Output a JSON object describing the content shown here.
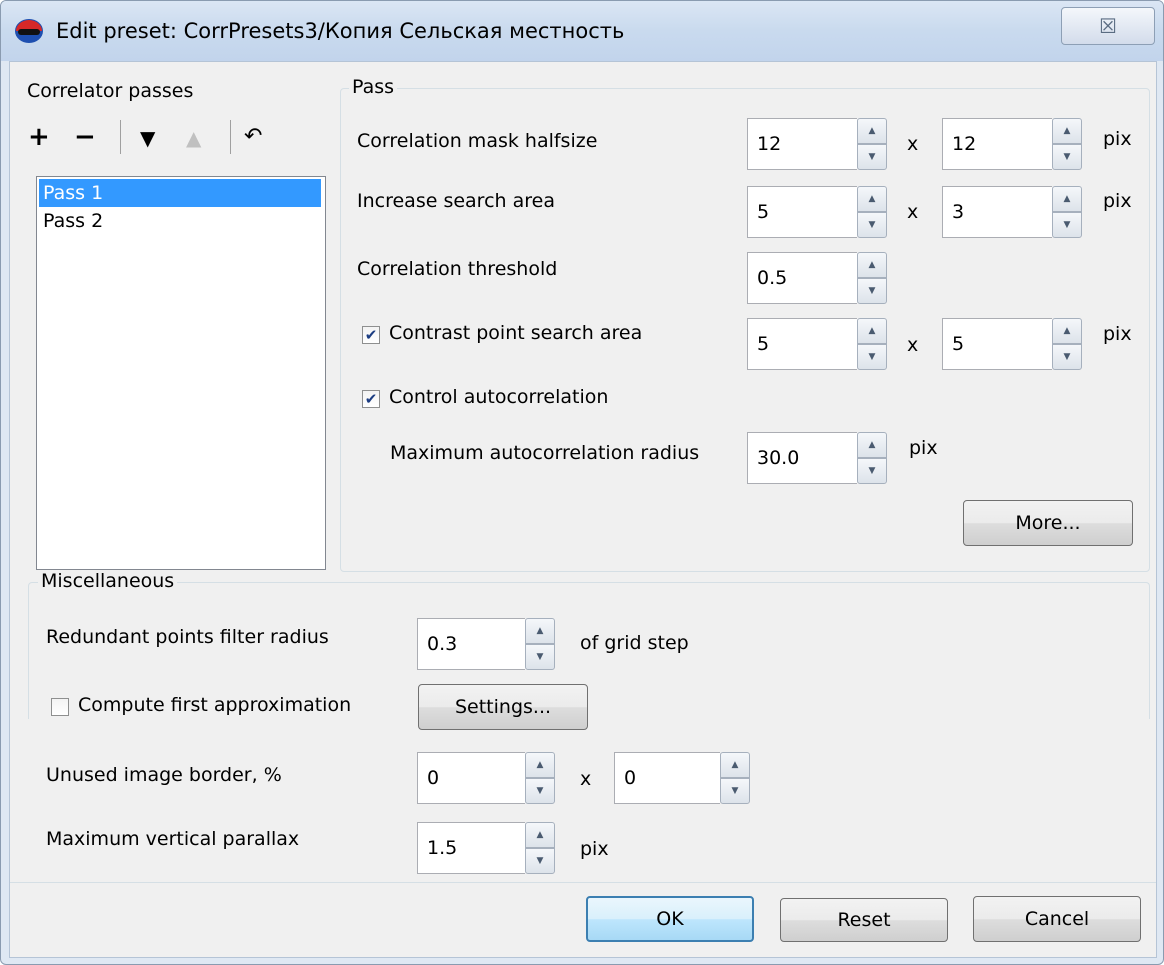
{
  "window": {
    "title": "Edit preset: CorrPresets3/Копия Сельская местность",
    "close_glyph": "☒"
  },
  "passes": {
    "label": "Correlator passes",
    "toolbar": {
      "add": "+",
      "remove": "−",
      "down": "▼",
      "up": "▲",
      "undo": "↶"
    },
    "items": [
      {
        "label": "Pass 1",
        "selected": true
      },
      {
        "label": "Pass 2",
        "selected": false
      }
    ]
  },
  "pass": {
    "group_title": "Pass",
    "mask_halfsize": {
      "label": "Correlation mask halfsize",
      "x": "12",
      "y": "12",
      "sep": "x",
      "unit": "pix"
    },
    "search_area": {
      "label": "Increase search area",
      "x": "5",
      "y": "3",
      "sep": "x",
      "unit": "pix"
    },
    "threshold": {
      "label": "Correlation threshold",
      "value": "0.5"
    },
    "contrast_area": {
      "label": "Contrast point search area",
      "checked": true,
      "x": "5",
      "y": "5",
      "sep": "x",
      "unit": "pix"
    },
    "control_autocorrelation": {
      "label": "Control autocorrelation",
      "checked": true
    },
    "max_autocorr_radius": {
      "label": "Maximum autocorrelation radius",
      "value": "30.0",
      "unit": "pix"
    },
    "more_button": "More..."
  },
  "misc": {
    "group_title": "Miscellaneous",
    "redundant_filter": {
      "label": "Redundant points filter radius",
      "value": "0.3",
      "unit": "of grid step"
    },
    "first_approx": {
      "label": "Compute first approximation",
      "checked": false,
      "settings_button": "Settings..."
    },
    "unused_border": {
      "label": "Unused image border, %",
      "x": "0",
      "y": "0",
      "sep": "x"
    },
    "max_parallax": {
      "label": "Maximum vertical parallax",
      "value": "1.5",
      "unit": "pix"
    }
  },
  "footer": {
    "ok": "OK",
    "reset": "Reset",
    "cancel": "Cancel"
  },
  "spin_glyphs": {
    "up": "▲",
    "down": "▼"
  },
  "check_glyph": "✔",
  "colors": {
    "selection": "#3399ff",
    "title_bar": "#c9daee",
    "dialog_bg": "#f0f0f0"
  }
}
